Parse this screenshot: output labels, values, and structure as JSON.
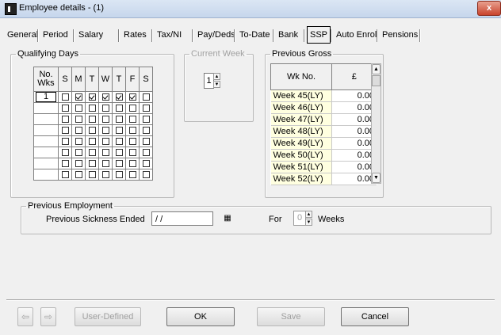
{
  "window": {
    "title": "Employee details -  (1)",
    "close_label": "x"
  },
  "tabs": [
    {
      "label": "General"
    },
    {
      "label": "Period"
    },
    {
      "label": "Salary"
    },
    {
      "label": "Rates"
    },
    {
      "label": "Tax/NI"
    },
    {
      "label": "Pay/Deds"
    },
    {
      "label": "To-Date"
    },
    {
      "label": "Bank"
    },
    {
      "label": "SSP"
    },
    {
      "label": "Auto Enrol"
    },
    {
      "label": "Pensions"
    }
  ],
  "active_tab": "SSP",
  "qualifying_days": {
    "legend": "Qualifying Days",
    "header_no_wks": "No.\nWks",
    "days": [
      "S",
      "M",
      "T",
      "W",
      "T",
      "F",
      "S"
    ],
    "rows": [
      {
        "weeks": "1",
        "checked": [
          false,
          true,
          true,
          true,
          true,
          true,
          false
        ]
      },
      {
        "weeks": "",
        "checked": [
          false,
          false,
          false,
          false,
          false,
          false,
          false
        ]
      },
      {
        "weeks": "",
        "checked": [
          false,
          false,
          false,
          false,
          false,
          false,
          false
        ]
      },
      {
        "weeks": "",
        "checked": [
          false,
          false,
          false,
          false,
          false,
          false,
          false
        ]
      },
      {
        "weeks": "",
        "checked": [
          false,
          false,
          false,
          false,
          false,
          false,
          false
        ]
      },
      {
        "weeks": "",
        "checked": [
          false,
          false,
          false,
          false,
          false,
          false,
          false
        ]
      },
      {
        "weeks": "",
        "checked": [
          false,
          false,
          false,
          false,
          false,
          false,
          false
        ]
      },
      {
        "weeks": "",
        "checked": [
          false,
          false,
          false,
          false,
          false,
          false,
          false
        ]
      }
    ]
  },
  "current_week": {
    "legend": "Current Week",
    "value": "1"
  },
  "previous_gross": {
    "legend": "Previous Gross",
    "col_week": "Wk No.",
    "col_amount": "£",
    "rows": [
      {
        "week": "Week 45(LY)",
        "amount": "0.00"
      },
      {
        "week": "Week 46(LY)",
        "amount": "0.00"
      },
      {
        "week": "Week 47(LY)",
        "amount": "0.00"
      },
      {
        "week": "Week 48(LY)",
        "amount": "0.00"
      },
      {
        "week": "Week 49(LY)",
        "amount": "0.00"
      },
      {
        "week": "Week 50(LY)",
        "amount": "0.00"
      },
      {
        "week": "Week 51(LY)",
        "amount": "0.00"
      },
      {
        "week": "Week 52(LY)",
        "amount": "0.00"
      }
    ]
  },
  "previous_employment": {
    "legend": "Previous Employment",
    "sickness_label": "Previous Sickness Ended",
    "sickness_value": "/ /",
    "for_label": "For",
    "weeks_value": "0",
    "weeks_label": "Weeks"
  },
  "buttons": {
    "prev": "⇦",
    "next": "⇨",
    "user_defined": "User-Defined",
    "ok": "OK",
    "save": "Save",
    "cancel": "Cancel"
  }
}
